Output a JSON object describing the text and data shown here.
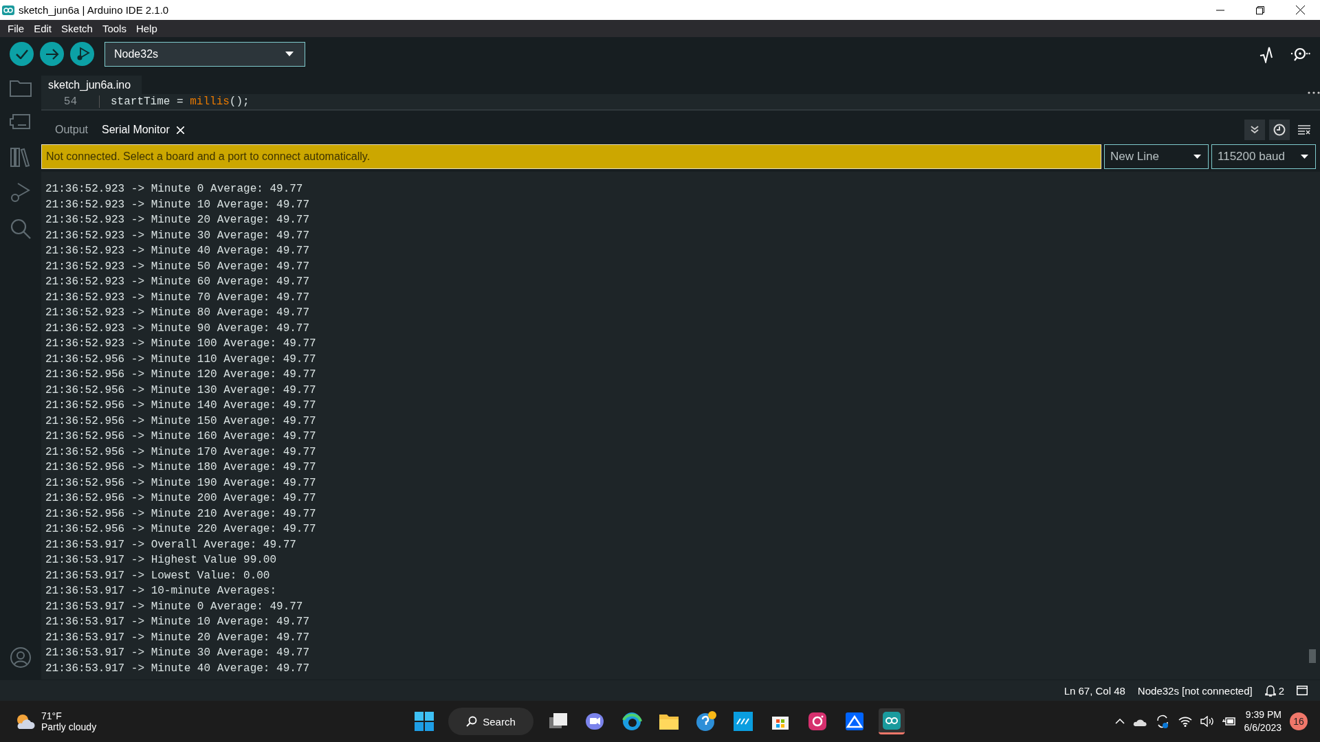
{
  "window": {
    "title": "sketch_jun6a | Arduino IDE 2.1.0"
  },
  "menu": [
    "File",
    "Edit",
    "Sketch",
    "Tools",
    "Help"
  ],
  "toolbar": {
    "board": "Node32s"
  },
  "editor": {
    "tab": "sketch_jun6a.ino",
    "line_number": "54",
    "code": [
      {
        "text": "startTime = ",
        "kind": "plain"
      },
      {
        "text": "millis",
        "kind": "function"
      },
      {
        "text": "();",
        "kind": "plain"
      }
    ]
  },
  "panel_tabs": [
    {
      "label": "Output",
      "selected": false,
      "closable": false
    },
    {
      "label": "Serial Monitor",
      "selected": true,
      "closable": true
    }
  ],
  "notice": "Not connected. Select a board and a port to connect automatically.",
  "line_ending": "New Line",
  "baud": "115200 baud",
  "serial_lines": [
    "21:36:52.923 -> Minute 0 Average: 49.77",
    "21:36:52.923 -> Minute 10 Average: 49.77",
    "21:36:52.923 -> Minute 20 Average: 49.77",
    "21:36:52.923 -> Minute 30 Average: 49.77",
    "21:36:52.923 -> Minute 40 Average: 49.77",
    "21:36:52.923 -> Minute 50 Average: 49.77",
    "21:36:52.923 -> Minute 60 Average: 49.77",
    "21:36:52.923 -> Minute 70 Average: 49.77",
    "21:36:52.923 -> Minute 80 Average: 49.77",
    "21:36:52.923 -> Minute 90 Average: 49.77",
    "21:36:52.923 -> Minute 100 Average: 49.77",
    "21:36:52.956 -> Minute 110 Average: 49.77",
    "21:36:52.956 -> Minute 120 Average: 49.77",
    "21:36:52.956 -> Minute 130 Average: 49.77",
    "21:36:52.956 -> Minute 140 Average: 49.77",
    "21:36:52.956 -> Minute 150 Average: 49.77",
    "21:36:52.956 -> Minute 160 Average: 49.77",
    "21:36:52.956 -> Minute 170 Average: 49.77",
    "21:36:52.956 -> Minute 180 Average: 49.77",
    "21:36:52.956 -> Minute 190 Average: 49.77",
    "21:36:52.956 -> Minute 200 Average: 49.77",
    "21:36:52.956 -> Minute 210 Average: 49.77",
    "21:36:52.956 -> Minute 220 Average: 49.77",
    "21:36:53.917 -> Overall Average: 49.77",
    "21:36:53.917 -> Highest Value 99.00",
    "21:36:53.917 -> Lowest Value: 0.00",
    "21:36:53.917 -> 10-minute Averages:",
    "21:36:53.917 -> Minute 0 Average: 49.77",
    "21:36:53.917 -> Minute 10 Average: 49.77",
    "21:36:53.917 -> Minute 20 Average: 49.77",
    "21:36:53.917 -> Minute 30 Average: 49.77",
    "21:36:53.917 -> Minute 40 Average: 49.77"
  ],
  "status_bar": {
    "position": "Ln 67, Col 48",
    "board": "Node32s [not connected]",
    "notifications": "2"
  },
  "taskbar": {
    "temperature": "71°F",
    "weather": "Partly cloudy",
    "search": "Search",
    "time": "9:39 PM",
    "date": "6/6/2023",
    "badge": "16"
  }
}
